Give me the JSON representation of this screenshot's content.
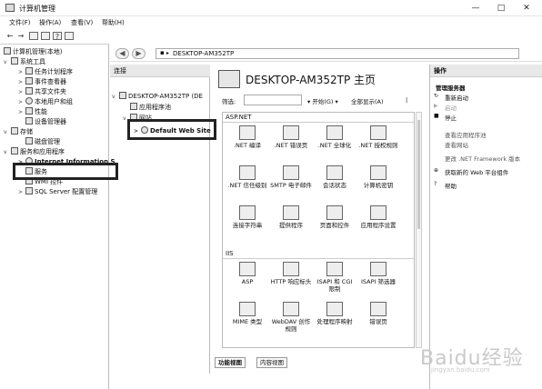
{
  "window": {
    "title": "计算机管理"
  },
  "window_controls": {
    "minimize": "—",
    "maximize": "□",
    "close": "✕"
  },
  "menu": [
    "文件(F)",
    "操作(A)",
    "查看(V)",
    "帮助(H)"
  ],
  "toolbar_icons": [
    "back-arrow",
    "forward-arrow",
    "console-tree",
    "properties",
    "help",
    "show-hide"
  ],
  "left_tree": [
    {
      "label": "计算机管理(本地)",
      "level": 0,
      "expand": ""
    },
    {
      "label": "系统工具",
      "level": 1,
      "expand": "v"
    },
    {
      "label": "任务计划程序",
      "level": 2,
      "expand": ">"
    },
    {
      "label": "事件查看器",
      "level": 2,
      "expand": ">"
    },
    {
      "label": "共享文件夹",
      "level": 2,
      "expand": ">"
    },
    {
      "label": "本地用户和组",
      "level": 2,
      "expand": ">"
    },
    {
      "label": "性能",
      "level": 2,
      "expand": ">"
    },
    {
      "label": "设备管理器",
      "level": 2,
      "expand": ""
    },
    {
      "label": "存储",
      "level": 1,
      "expand": "v"
    },
    {
      "label": "磁盘管理",
      "level": 2,
      "expand": ""
    },
    {
      "label": "服务和应用程序",
      "level": 1,
      "expand": "v"
    },
    {
      "label": "Internet Information S",
      "level": 2,
      "expand": ">"
    },
    {
      "label": "服务",
      "level": 2,
      "expand": ""
    },
    {
      "label": "WMI 控件",
      "level": 2,
      "expand": ""
    },
    {
      "label": "SQL Server 配置管理",
      "level": 2,
      "expand": ">"
    }
  ],
  "address": {
    "path": "DESKTOP-AM352TP",
    "sep": "▸"
  },
  "connections": {
    "header": "连接",
    "items": [
      {
        "label": "DESKTOP-AM352TP (DE",
        "level": 0,
        "expand": "v"
      },
      {
        "label": "应用程序池",
        "level": 1,
        "expand": ""
      },
      {
        "label": "网站",
        "level": 1,
        "expand": "v"
      },
      {
        "label": "Default Web Site",
        "level": 2,
        "expand": ">"
      }
    ]
  },
  "center": {
    "title": "DESKTOP-AM352TP 主页",
    "filter_label": "筛选:",
    "start_button": "▾ 开始(G) ▾",
    "show_all_button": "全部显示(A)",
    "groupby_label": "|",
    "groups": [
      {
        "name": "ASP.NET",
        "features": [
          ".NET 编译",
          ".NET 错误页",
          ".NET 全球化",
          ".NET 授权规则",
          ".NET 信任级别",
          "SMTP 电子邮件",
          "会话状态",
          "计算机密钥",
          "连接字符串",
          "提供程序",
          "页面和控件",
          "应用程序设置"
        ]
      },
      {
        "name": "IIS",
        "features": [
          "ASP",
          "HTTP 响应标头",
          "ISAPI 和 CGI 限制",
          "ISAPI 筛选器",
          "MIME 类型",
          "WebDAV 创作规则",
          "处理程序映射",
          "错误页"
        ]
      }
    ],
    "view_tabs": [
      "功能视图",
      "内容视图"
    ]
  },
  "actions": {
    "header": "操作",
    "items": [
      {
        "label": "管理服务器",
        "kind": "heading"
      },
      {
        "label": "重新启动",
        "kind": "action",
        "icon": "↻"
      },
      {
        "label": "启动",
        "kind": "disabled",
        "icon": "▶"
      },
      {
        "label": "停止",
        "kind": "action",
        "icon": "■"
      },
      {
        "label": "查看应用程序池",
        "kind": "link"
      },
      {
        "label": "查看网站",
        "kind": "link"
      },
      {
        "label": "更改 .NET Framework 版本",
        "kind": "link"
      },
      {
        "label": "获取新的 Web 平台组件",
        "kind": "link",
        "icon": "⊕"
      },
      {
        "label": "帮助",
        "kind": "link",
        "icon": "?"
      }
    ]
  },
  "watermark": {
    "main": "Baidu经验",
    "sub": "jingyan.baidu.com"
  }
}
